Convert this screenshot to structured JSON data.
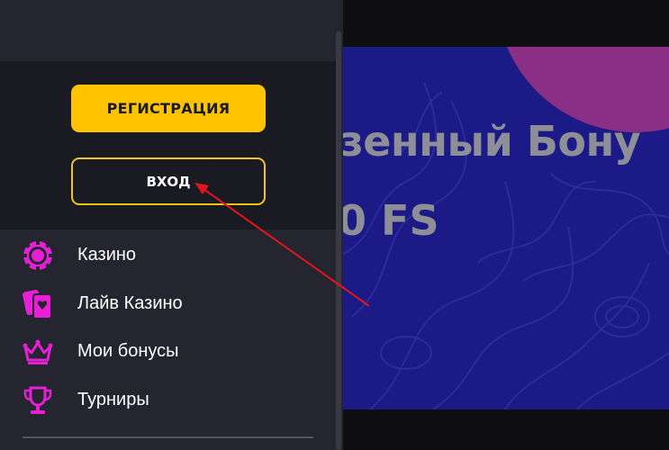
{
  "sidebar": {
    "register_label": "РЕГИСТРАЦИЯ",
    "login_label": "ВХОД",
    "items": [
      {
        "label": "Казино",
        "icon": "casino-chip-icon"
      },
      {
        "label": "Лайв Казино",
        "icon": "playing-cards-icon"
      },
      {
        "label": "Мои бонусы",
        "icon": "crown-icon"
      },
      {
        "label": "Турниры",
        "icon": "trophy-icon"
      }
    ]
  },
  "banner": {
    "line1": "зенный Бону",
    "line2": "0 FS"
  },
  "colors": {
    "accent_yellow": "#ffc300",
    "icon_magenta": "#e81fd6",
    "banner_blue": "#1c1a86",
    "annotation_red": "#e3141c"
  }
}
